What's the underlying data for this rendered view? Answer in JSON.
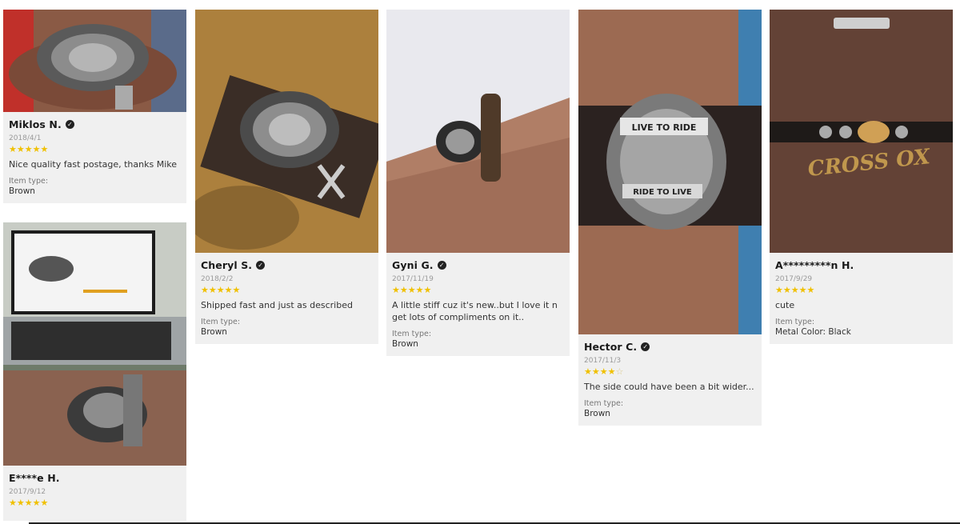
{
  "reviews": [
    {
      "name": "Miklos N.",
      "date": "2018/4/1",
      "rating": 5,
      "text": "Nice quality fast postage, thanks Mike",
      "item_type_label": "Item type:",
      "item_type_value": "Brown"
    },
    {
      "name": "E****e H.",
      "date": "2017/9/12",
      "rating": 5,
      "text": "",
      "item_type_label": "",
      "item_type_value": ""
    },
    {
      "name": "Cheryl S.",
      "date": "2018/2/2",
      "rating": 5,
      "text": "Shipped fast  and just as described",
      "item_type_label": "Item type:",
      "item_type_value": "Brown"
    },
    {
      "name": "Gyni G.",
      "date": "2017/11/19",
      "rating": 5,
      "text": "A little stiff cuz it's new..but I love it n get lots of compliments on it..",
      "item_type_label": "Item type:",
      "item_type_value": "Brown"
    },
    {
      "name": "Hector C.",
      "date": "2017/11/3",
      "rating": 4,
      "text": "The side could have been a bit wider...",
      "item_type_label": "Item type:",
      "item_type_value": "Brown"
    },
    {
      "name": "A*********n H.",
      "date": "2017/9/29",
      "rating": 5,
      "text": "cute",
      "item_type_label": "Item type:",
      "item_type_value": "Metal Color: Black"
    }
  ],
  "photo_text": {
    "live_to_ride": "LIVE TO RIDE",
    "ride_to_live": "RIDE TO LIVE",
    "bag_brand": "CROSS OX"
  },
  "icons": {
    "verified": "verified-check-icon",
    "star": "star-icon"
  },
  "colors": {
    "card_bg": "#f0f0f0",
    "star": "#f0c000"
  }
}
